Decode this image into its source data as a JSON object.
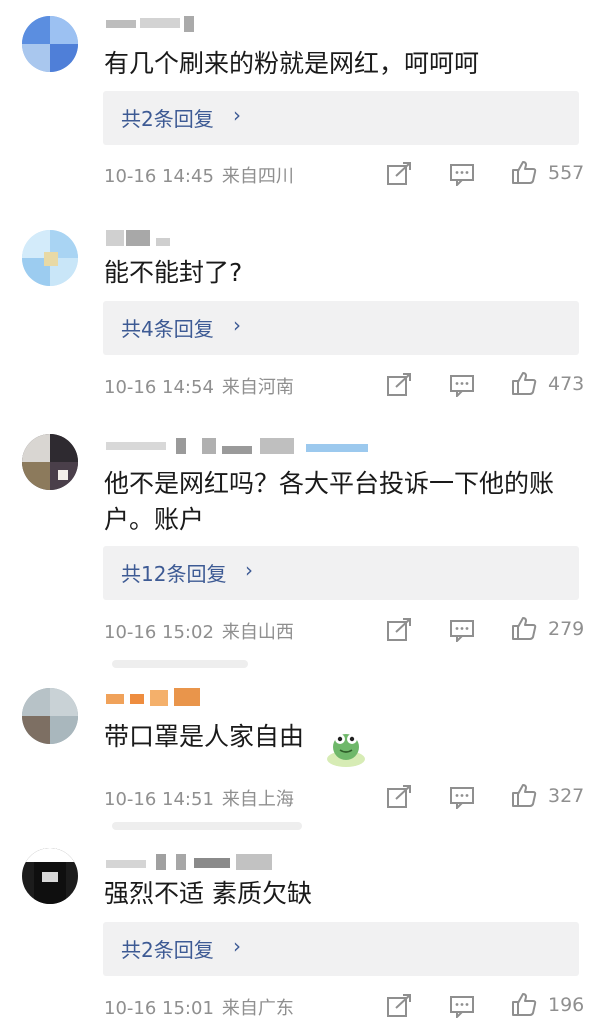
{
  "comments": [
    {
      "text": "有几个刷来的粉就是网红，呵呵呵",
      "reply": "共2条回复",
      "time": "10-16 14:45",
      "location": "来自四川",
      "likes": "557"
    },
    {
      "text": "能不能封了?",
      "reply": "共4条回复",
      "time": "10-16 14:54",
      "location": "来自河南",
      "likes": "473"
    },
    {
      "text": "他不是网红吗？各大平台投诉一下他的账户。账户",
      "reply": "共12条回复",
      "time": "10-16 15:02",
      "location": "来自山西",
      "likes": "279"
    },
    {
      "text": "带口罩是人家自由",
      "reply": "",
      "time": "10-16 14:51",
      "location": "来自上海",
      "likes": "327"
    },
    {
      "text": "强烈不适 素质欠缺",
      "reply": "共2条回复",
      "time": "10-16 15:01",
      "location": "来自广东",
      "likes": "196"
    }
  ],
  "reply_chevron": "›",
  "icons": {
    "repost": "repost-icon",
    "comment": "comment-icon",
    "like": "thumbs-up-icon",
    "sticker": "frog-sticker-icon"
  },
  "colors": {
    "link": "#3d5a94",
    "meta": "#8f8f8f",
    "reply_bg": "#f1f1f2"
  }
}
